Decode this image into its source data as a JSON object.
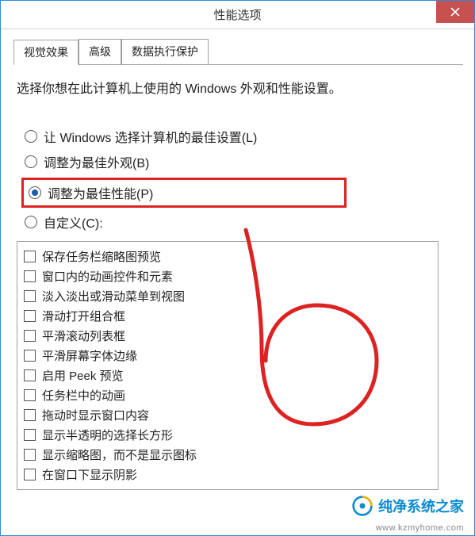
{
  "titlebar": {
    "title": "性能选项"
  },
  "tabs": [
    {
      "label": "视觉效果",
      "active": true
    },
    {
      "label": "高级",
      "active": false
    },
    {
      "label": "数据执行保护",
      "active": false
    }
  ],
  "panel": {
    "description": "选择你想在此计算机上使用的 Windows 外观和性能设置。",
    "radios": [
      {
        "label": "让 Windows 选择计算机的最佳设置(L)",
        "selected": false
      },
      {
        "label": "调整为最佳外观(B)",
        "selected": false
      },
      {
        "label": "调整为最佳性能(P)",
        "selected": true,
        "highlighted": true
      },
      {
        "label": "自定义(C):",
        "selected": false
      }
    ],
    "checkboxes": [
      {
        "label": "保存任务栏缩略图预览",
        "checked": false
      },
      {
        "label": "窗口内的动画控件和元素",
        "checked": false
      },
      {
        "label": "淡入淡出或滑动菜单到视图",
        "checked": false
      },
      {
        "label": "滑动打开组合框",
        "checked": false
      },
      {
        "label": "平滑滚动列表框",
        "checked": false
      },
      {
        "label": "平滑屏幕字体边缘",
        "checked": false
      },
      {
        "label": "启用 Peek 预览",
        "checked": false
      },
      {
        "label": "任务栏中的动画",
        "checked": false
      },
      {
        "label": "拖动时显示窗口内容",
        "checked": false
      },
      {
        "label": "显示半透明的选择长方形",
        "checked": false
      },
      {
        "label": "显示缩略图，而不是显示图标",
        "checked": false
      },
      {
        "label": "在窗口下显示阴影",
        "checked": false
      }
    ]
  },
  "watermark": {
    "text": "纯净系统之家",
    "url": "www.kzmyhome.com"
  }
}
